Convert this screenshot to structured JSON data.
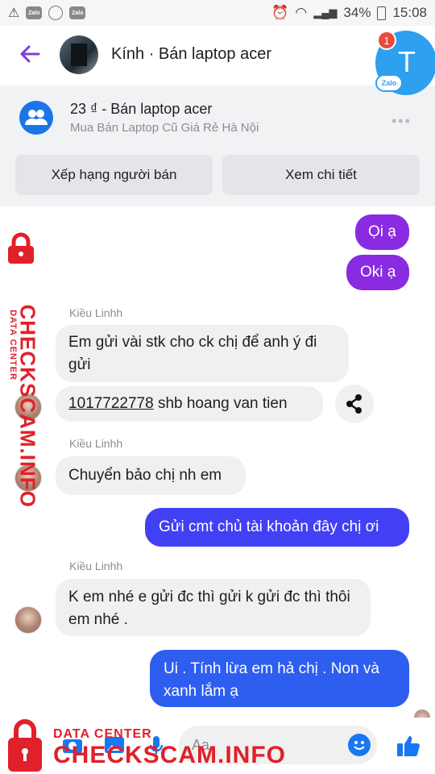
{
  "status_bar": {
    "app1": "Zalo",
    "app2": "Zalo",
    "battery": "34%",
    "time": "15:08"
  },
  "header": {
    "title": "Kính · Bán laptop acer"
  },
  "zalo": {
    "badge": "1",
    "letter": "T",
    "label": "Zalo"
  },
  "listing": {
    "price": "23 ₫ - Bán laptop acer",
    "subtitle": "Mua Bán Laptop Cũ Giá Rẻ Hà Nội",
    "more": "•••",
    "rate_button": "Xếp hạng người bán",
    "detail_button": "Xem chi tiết"
  },
  "messages": [
    {
      "text": "Ọi ạ"
    },
    {
      "text": "Oki ạ"
    },
    {
      "sender": "Kiều Linhh",
      "text": "Em gửi vài stk cho ck chị để anh ý đi gửi"
    },
    {
      "account": "1017722778",
      "rest": " shb hoang van tien"
    },
    {
      "sender": "Kiều Linhh",
      "text": "Chuyển bảo chị nh em"
    },
    {
      "text": "Gửi cmt chủ tài khoản đây chị ơi"
    },
    {
      "sender": "Kiều Linhh",
      "text": "K em nhé e gửi đc thì gửi k gửi đc thì thôi em nhé ."
    },
    {
      "text": "Ui . Tính lừa  em hả chị . Non và xanh lắm ạ"
    }
  ],
  "composer": {
    "placeholder": "Aa"
  },
  "watermark": {
    "side_small": "DATA CENTER",
    "side_big": "CHECKSCAM.INFO",
    "bottom_small": "DATA CENTER",
    "bottom_big": "CHECKSCAM.INFO"
  },
  "colors": {
    "purple": "#8a2be2",
    "indigo": "#4240f4",
    "blue": "#2d5ef0",
    "messenger": "#1877f2",
    "watermark": "#e0202a"
  }
}
